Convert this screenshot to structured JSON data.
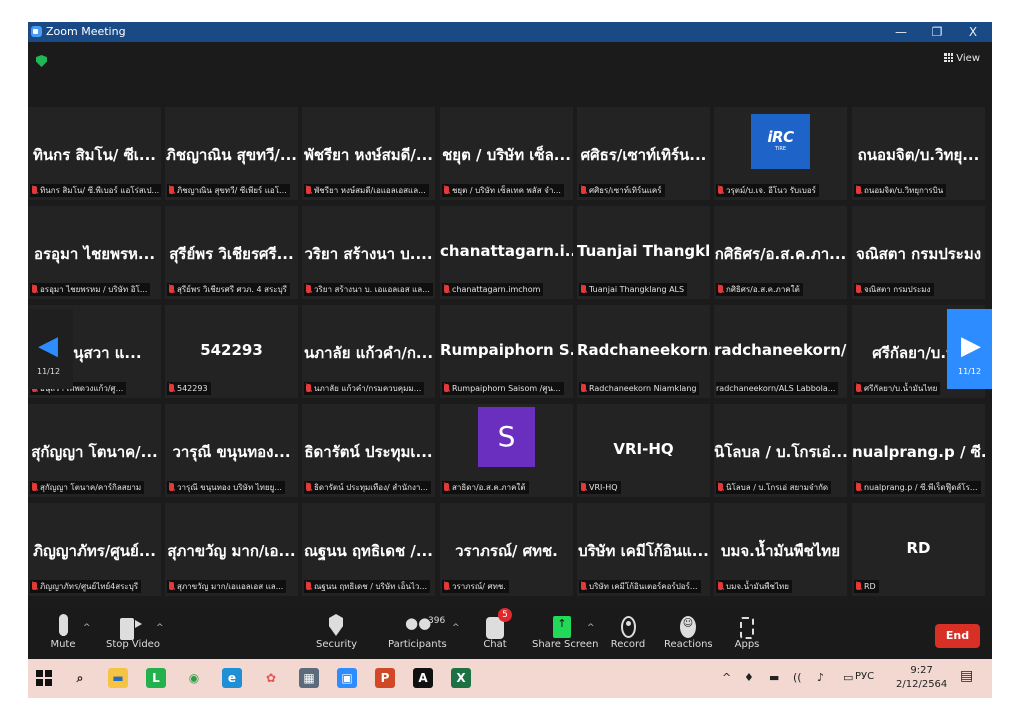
{
  "window": {
    "title": "Zoom Meeting",
    "minimize_glyph": "—",
    "restore_glyph": "❐",
    "close_glyph": "X"
  },
  "header": {
    "view_label": "View"
  },
  "gallery": {
    "rows": [
      [
        {
          "name": "ทินกร สิมโน/ ซีเ...",
          "label": "ทินกร สิมโน/ ซี.พีเบอร์ แอโร่สเป..."
        },
        {
          "name": "ภิชญาณิน สุขทวี/...",
          "label": "ภิชญาณิน สุขทวี/ ซีเพียร์ แอโ..."
        },
        {
          "name": "พัชรียา หงษ์สมดี/...",
          "label": "พัชรียา หงษ์สมดี/เอแอลเอสแล..."
        },
        {
          "name": "ชยุต / บริษัท เซ็ล...",
          "label": "ชยุต / บริษัท เซ็ลเทค พลัส จำ..."
        },
        {
          "name": "ศศิธร/เซาท์เทิร์น...",
          "label": "ศศิธร/เซาท์เทิร์นแคร์"
        },
        {
          "name": "",
          "label": "วรุตม์/บ.เจ. อีโนว รับเบอร์",
          "logo": "iRC",
          "logo_sub": "TIRE"
        },
        {
          "name": "ถนอมจิต/บ.วิทยุ...",
          "label": "ถนอมจิต/บ.วิทยุการบิน"
        }
      ],
      [
        {
          "name": "อรอุมา ไชยพรห...",
          "label": "อรอุมา ไชยพรหม / บริษัท อิโ..."
        },
        {
          "name": "สุรีย์พร วิเชียรศรี...",
          "label": "สุรีย์พร วิเชียรศรี ศวภ. 4 สระบุรี"
        },
        {
          "name": "วริยา สร้างนา บ....",
          "label": "วริยา สร้างนา บ. เอแอลเอส แล..."
        },
        {
          "name": "chanattagarn.i...",
          "label": "chanattagarn.imchom"
        },
        {
          "name": "Tuanjai Thangkl...",
          "label": "Tuanjai Thangklang ALS"
        },
        {
          "name": "กศิธิศร/อ.ส.ค.ภา...",
          "label": "กศิธิศร/อ.ส.ค.ภาคใต้"
        },
        {
          "name": "จณิสตา กรมประมง",
          "label": "จณิสตา กรมประมง"
        }
      ],
      [
        {
          "name": "าวอนุสวา แ...",
          "label": "อนุสรา เพพดวงแก้ว/ศู..."
        },
        {
          "name": "542293",
          "label": "542293"
        },
        {
          "name": "นภาลัย แก้วคำ/ก...",
          "label": "นภาลัย แก้วคำ/กรมควบคุมม..."
        },
        {
          "name": "Rumpaiphorn S...",
          "label": "Rumpaiphorn Saisom /ศูน..."
        },
        {
          "name": "Radchaneekorn...",
          "label": "Radchaneekorn Niamklang"
        },
        {
          "name": "radchaneekorn/...",
          "label": "radchaneekorn/ALS Labbola..."
        },
        {
          "name": "ศรีกัลยา/บ.น้ำ",
          "label": "ศรีกัลยา/บ.น้ำมันไทย"
        }
      ],
      [
        {
          "name": "สุกัญญา โตนาค/...",
          "label": "สุกัญญา โตนาค/คาร์กิลสยาม"
        },
        {
          "name": "วารุณี ขนุนทอง...",
          "label": "วารุณี ขนุนทอง บริษัท ไทยยู..."
        },
        {
          "name": "ธิดารัตน์ ประทุมเ...",
          "label": "ธิดารัตน์ ประทุมเทือง/ สำนักงา..."
        },
        {
          "name": "",
          "label": "สาธิดา/อ.ส.ค.ภาคใต้",
          "avatar": "S"
        },
        {
          "name": "VRI-HQ",
          "label": "VRI-HQ"
        },
        {
          "name": "นิโลบล / บ.โกรเอ่...",
          "label": "นิโลบล / บ.โกรเอ่ สยามจำกัด"
        },
        {
          "name": "nualprang.p / ซี...",
          "label": "nualprang.p / ซี.พีเร็ดฟู๊ดส์โร..."
        }
      ],
      [
        {
          "name": "ภิญญาภัทร/ศูนย์...",
          "label": "ภิญญาภัทร/ศูนย์ไทย์4สระบุรี"
        },
        {
          "name": "สุภาขวัญ มาก/เอ...",
          "label": "สุภาขวัญ มาก/เอแอลเอส แล..."
        },
        {
          "name": "ณฐนน ฤทธิเดช /...",
          "label": "ณฐนน ฤทธิเดช / บริษัท เอ็นไว..."
        },
        {
          "name": "วราภรณ์/ ศทช.",
          "label": "วราภรณ์/ ศทช."
        },
        {
          "name": "บริษัท เคมีโก้อินแ...",
          "label": "บริษัท เคมีโก้อินเตอร์คอร์ปอร์..."
        },
        {
          "name": "บมจ.น้ำมันพืชไทย",
          "label": "บมจ.น้ำมันพืชไทย"
        },
        {
          "name": "RD",
          "label": "RD"
        }
      ]
    ],
    "page_left": "11/12",
    "page_right": "11/12",
    "prev_glyph": "◀",
    "next_glyph": "▶"
  },
  "toolbar": {
    "mute": "Mute",
    "stop_video": "Stop Video",
    "security": "Security",
    "participants": "Participants",
    "participants_count": "396",
    "chat": "Chat",
    "chat_badge": "5",
    "share_screen": "Share Screen",
    "record": "Record",
    "reactions": "Reactions",
    "apps": "Apps",
    "end": "End",
    "caret": "^"
  },
  "taskbar": {
    "clock_time": "9:27",
    "clock_date": "2/12/2564",
    "language": "РУС",
    "apps": [
      {
        "id": "search",
        "glyph": "⌕",
        "color": "#f3d8d2",
        "fg": "#222"
      },
      {
        "id": "explorer",
        "glyph": "▬",
        "color": "#f6c343",
        "fg": "#2a6bbd"
      },
      {
        "id": "line",
        "glyph": "L",
        "color": "#22b14c",
        "fg": "#fff"
      },
      {
        "id": "chrome",
        "glyph": "◉",
        "color": "#f3d8d2",
        "fg": "#2e9e45"
      },
      {
        "id": "edge",
        "glyph": "e",
        "color": "#1f8fd6",
        "fg": "#fff"
      },
      {
        "id": "paint",
        "glyph": "✿",
        "color": "#f3d8d2",
        "fg": "#e25555"
      },
      {
        "id": "calculator",
        "glyph": "▦",
        "color": "#5b6b7c",
        "fg": "#fff"
      },
      {
        "id": "zoom",
        "glyph": "▣",
        "color": "#2d8cff",
        "fg": "#fff"
      },
      {
        "id": "powerpoint",
        "glyph": "P",
        "color": "#d24726",
        "fg": "#fff"
      },
      {
        "id": "acrobat",
        "glyph": "A",
        "color": "#111",
        "fg": "#fff"
      },
      {
        "id": "excel",
        "glyph": "X",
        "color": "#1e7145",
        "fg": "#fff"
      }
    ],
    "tray_glyphs": [
      "^",
      "♦",
      "▬",
      "((",
      "♪",
      "▭"
    ]
  },
  "colors": {
    "titlebar": "#1a4a86",
    "accent": "#2d8cff",
    "end": "#d93025",
    "taskbar": "#f3d8d2"
  }
}
